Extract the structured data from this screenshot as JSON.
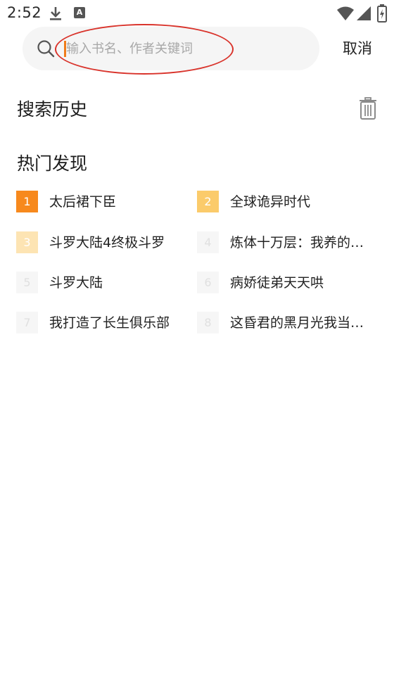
{
  "status_bar": {
    "time": "2:52",
    "icons": [
      "download-icon",
      "a-icon",
      "wifi-icon",
      "signal-icon",
      "battery-icon"
    ],
    "a_icon_text": "A"
  },
  "search": {
    "placeholder": "输入书名、作者关键词",
    "value": "",
    "cancel_label": "取消",
    "accent_color": "#f07c1b",
    "annotation_color": "#d9332b"
  },
  "history": {
    "title": "搜索历史",
    "clear_icon": "trash-icon"
  },
  "hot": {
    "title": "热门发现",
    "items": [
      {
        "rank": "1",
        "title": "太后裙下臣",
        "badge_color": "#f7891d",
        "text_color": "#ffffff"
      },
      {
        "rank": "2",
        "title": "全球诡异时代",
        "badge_color": "#fbcb6b",
        "text_color": "#ffffff"
      },
      {
        "rank": "3",
        "title": "斗罗大陆4终极斗罗",
        "badge_color": "#fde4b3",
        "text_color": "#ffffff"
      },
      {
        "rank": "4",
        "title": "炼体十万层：我养的狗都是大帝",
        "badge_color": "#f6f6f6",
        "text_color": "#e0e0e0"
      },
      {
        "rank": "5",
        "title": "斗罗大陆",
        "badge_color": "#f6f6f6",
        "text_color": "#e0e0e0"
      },
      {
        "rank": "6",
        "title": "病娇徒弟天天哄",
        "badge_color": "#f6f6f6",
        "text_color": "#e0e0e0"
      },
      {
        "rank": "7",
        "title": "我打造了长生俱乐部",
        "badge_color": "#f6f6f6",
        "text_color": "#e0e0e0"
      },
      {
        "rank": "8",
        "title": "这昏君的黑月光我当定了",
        "badge_color": "#f6f6f6",
        "text_color": "#e0e0e0"
      }
    ]
  }
}
